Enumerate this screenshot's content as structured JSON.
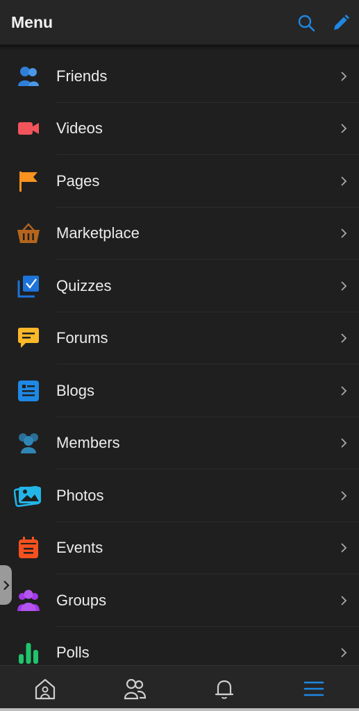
{
  "header": {
    "title": "Menu",
    "icons": [
      "search-icon",
      "edit-icon"
    ],
    "accent_color": "#1e88e5"
  },
  "menu": {
    "items": [
      {
        "label": "Friends",
        "icon": "friends-icon",
        "color": "#2f7fd8"
      },
      {
        "label": "Videos",
        "icon": "video-camera-icon",
        "color": "#f2545b"
      },
      {
        "label": "Pages",
        "icon": "flag-icon",
        "color": "#f7931e"
      },
      {
        "label": "Marketplace",
        "icon": "basket-icon",
        "color": "#b5651d"
      },
      {
        "label": "Quizzes",
        "icon": "quiz-checkbox-icon",
        "color": "#1e73d8"
      },
      {
        "label": "Forums",
        "icon": "chat-bubble-icon",
        "color": "#fbb829"
      },
      {
        "label": "Blogs",
        "icon": "blog-document-icon",
        "color": "#1e88e5"
      },
      {
        "label": "Members",
        "icon": "members-icon",
        "color": "#2a6f97"
      },
      {
        "label": "Photos",
        "icon": "photos-icon",
        "color": "#22b5e8"
      },
      {
        "label": "Events",
        "icon": "calendar-icon",
        "color": "#f4511e"
      },
      {
        "label": "Groups",
        "icon": "groups-icon",
        "color": "#a238e8"
      },
      {
        "label": "Polls",
        "icon": "bar-chart-icon",
        "color": "#1fc46b"
      }
    ]
  },
  "bottom_nav": {
    "items": [
      "home-icon",
      "friends-icon",
      "bell-icon",
      "hamburger-menu-icon"
    ],
    "active": "hamburger-menu-icon"
  }
}
